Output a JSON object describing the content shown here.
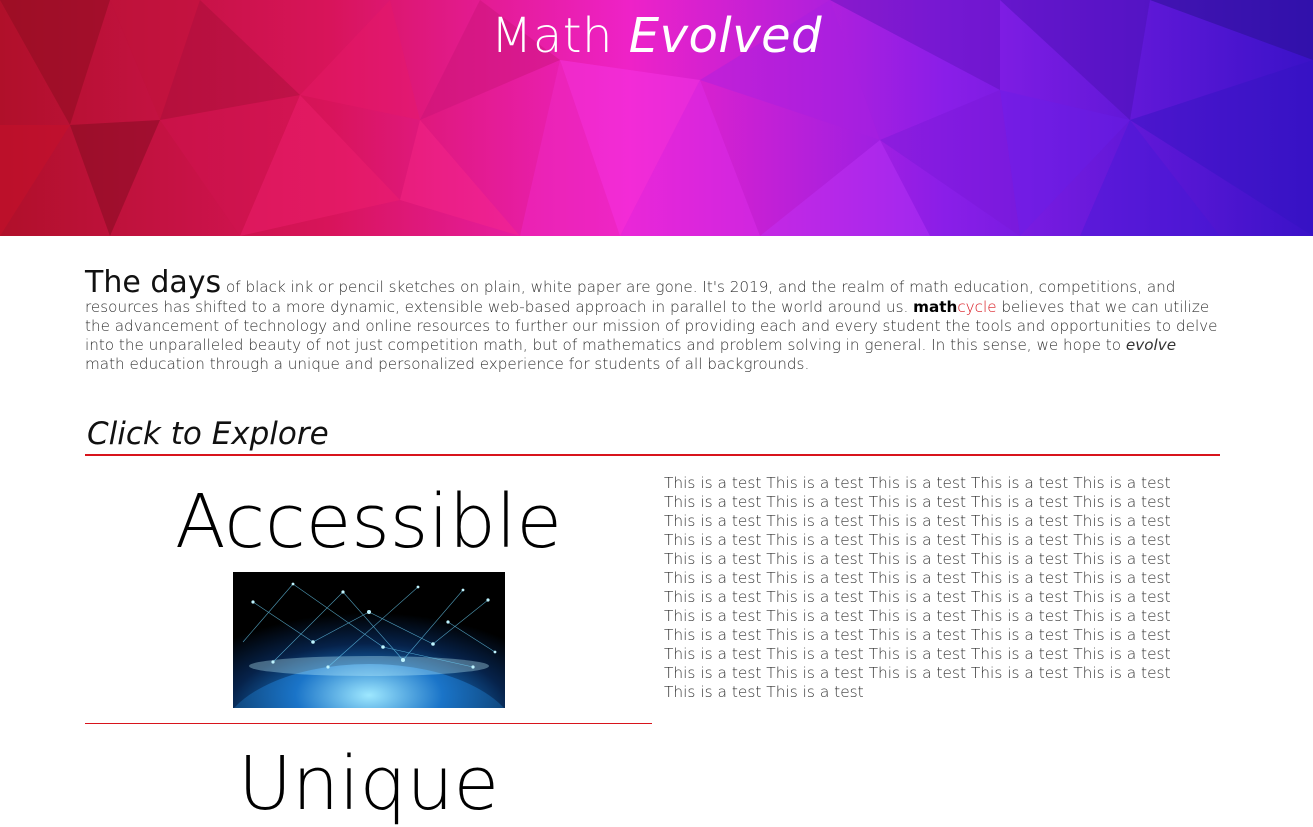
{
  "hero": {
    "title_plain": "Math",
    "title_em": "Evolved",
    "gradient_colors": [
      "#b0102a",
      "#e8128a",
      "#f026e0",
      "#8a1ee8",
      "#3a12c8"
    ]
  },
  "intro": {
    "lead": "The days",
    "text_1": " of black ink or pencil sketches on plain, white paper are gone. It's 2019, and the realm of math education, competitions, and resources has shifted to a more dynamic, extensible web-based approach in parallel to the world around us. ",
    "brand_a": "math",
    "brand_b": "cycle",
    "text_2": " believes that we can utilize the advancement of technology and online resources to further our mission of providing each and every student the tools and opportunities to delve into the unparalleled beauty of not just competition math, but of mathematics and problem solving in general. In this sense, we hope to ",
    "em": "evolve",
    "text_3": " math education through a unique and personalized experience for students of all backgrounds."
  },
  "explore": {
    "title": "Click to Explore"
  },
  "features": [
    {
      "title": "Accessible",
      "image_icon": "globe-network-image"
    },
    {
      "title": "Unique"
    }
  ],
  "side_text": "This is a test This is a test This is a test This is a test This is a test This is a test This is a test This is a test This is a test This is a test This is a test This is a test This is a test This is a test This is a test This is a test This is a test This is a test This is a test This is a test This is a test This is a test This is a test This is a test This is a test This is a test This is a test This is a test This is a test This is a test This is a test This is a test This is a test This is a test This is a test This is a test This is a test This is a test This is a test This is a test This is a test This is a test This is a test This is a test This is a test This is a test This is a test This is a test This is a test This is a test This is a test This is a test This is a test This is a test This is a test This is a test This is a test",
  "colors": {
    "accent": "#d8141c"
  }
}
